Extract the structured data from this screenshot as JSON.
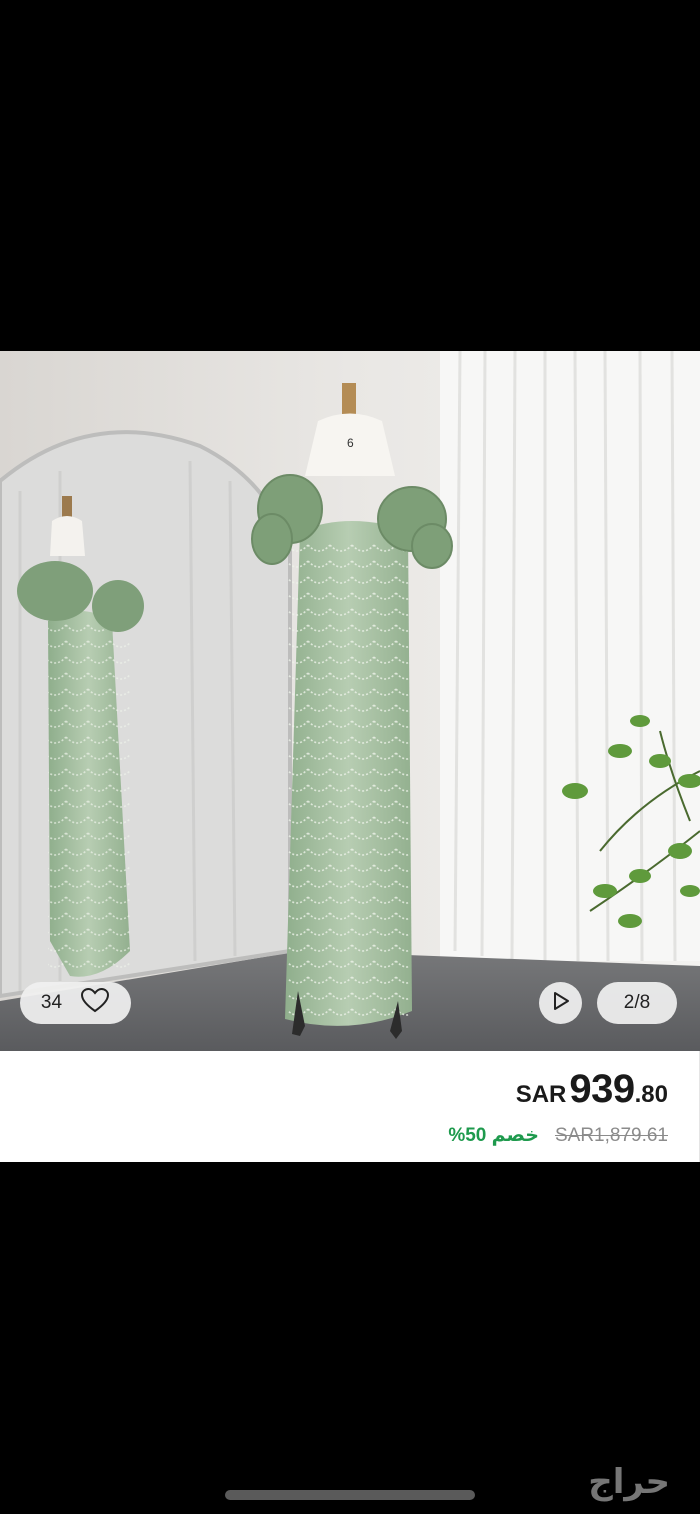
{
  "listing": {
    "likes_count": "34",
    "image_counter": "2/8",
    "price": {
      "currency": "SAR",
      "integer": "939",
      "decimal": ".80",
      "original": "SAR1,879.61",
      "discount": "خصم 50%"
    }
  },
  "watermark": {
    "text": "حراج"
  },
  "icons": {
    "like": "heart-icon",
    "video": "play-icon"
  },
  "colors": {
    "discount": "#1e9a4d",
    "price": "#1a1a1a",
    "original_price": "#8b8b8b"
  }
}
